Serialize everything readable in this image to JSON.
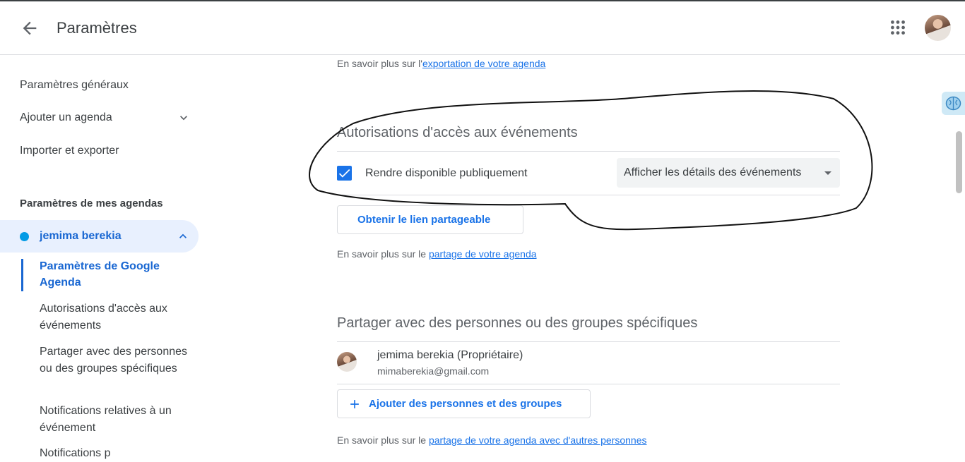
{
  "header": {
    "title": "Paramètres"
  },
  "sidebar": {
    "items": [
      {
        "label": "Paramètres généraux"
      },
      {
        "label": "Ajouter un agenda"
      },
      {
        "label": "Importer et exporter"
      }
    ],
    "my_calendars_heading": "Paramètres de mes agendas",
    "calendar_name": "jemima berekia",
    "calendar_color": "#039be5",
    "subitems": [
      {
        "label": "Paramètres de Google Agenda"
      },
      {
        "label": "Autorisations d'accès aux événements"
      },
      {
        "label": "Partager avec des personnes ou des groupes spécifiques"
      },
      {
        "label": "Notifications relatives à un événement"
      },
      {
        "label": "Notifications p"
      }
    ]
  },
  "main": {
    "export_help": {
      "prefix": "En savoir plus sur l'",
      "link": "exportation de votre agenda"
    },
    "access": {
      "heading": "Autorisations d'accès aux événements",
      "public_label": "Rendre disponible publiquement",
      "public_checked": true,
      "detail_select": "Afficher les détails des événements",
      "share_link_button": "Obtenir le lien partageable",
      "help": {
        "prefix": "En savoir plus sur le ",
        "link": "partage de votre agenda"
      }
    },
    "sharing": {
      "heading": "Partager avec des personnes ou des groupes spécifiques",
      "person_name": "jemima berekia (Propriétaire)",
      "person_email": "mimaberekia@gmail.com",
      "add_button": "Ajouter des personnes et des groupes",
      "help": {
        "prefix": "En savoir plus sur le ",
        "link": "partage de votre agenda avec d'autres personnes"
      }
    }
  },
  "colors": {
    "accent": "#1a73e8",
    "selected_bg": "#e8f0fe",
    "selected_text": "#1967d2"
  },
  "icons": [
    "arrow-back-icon",
    "apps-grid-icon",
    "chevron-down-icon",
    "chevron-up-icon",
    "checkmark-icon",
    "dropdown-caret-icon",
    "plus-icon",
    "brain-extension-icon"
  ]
}
